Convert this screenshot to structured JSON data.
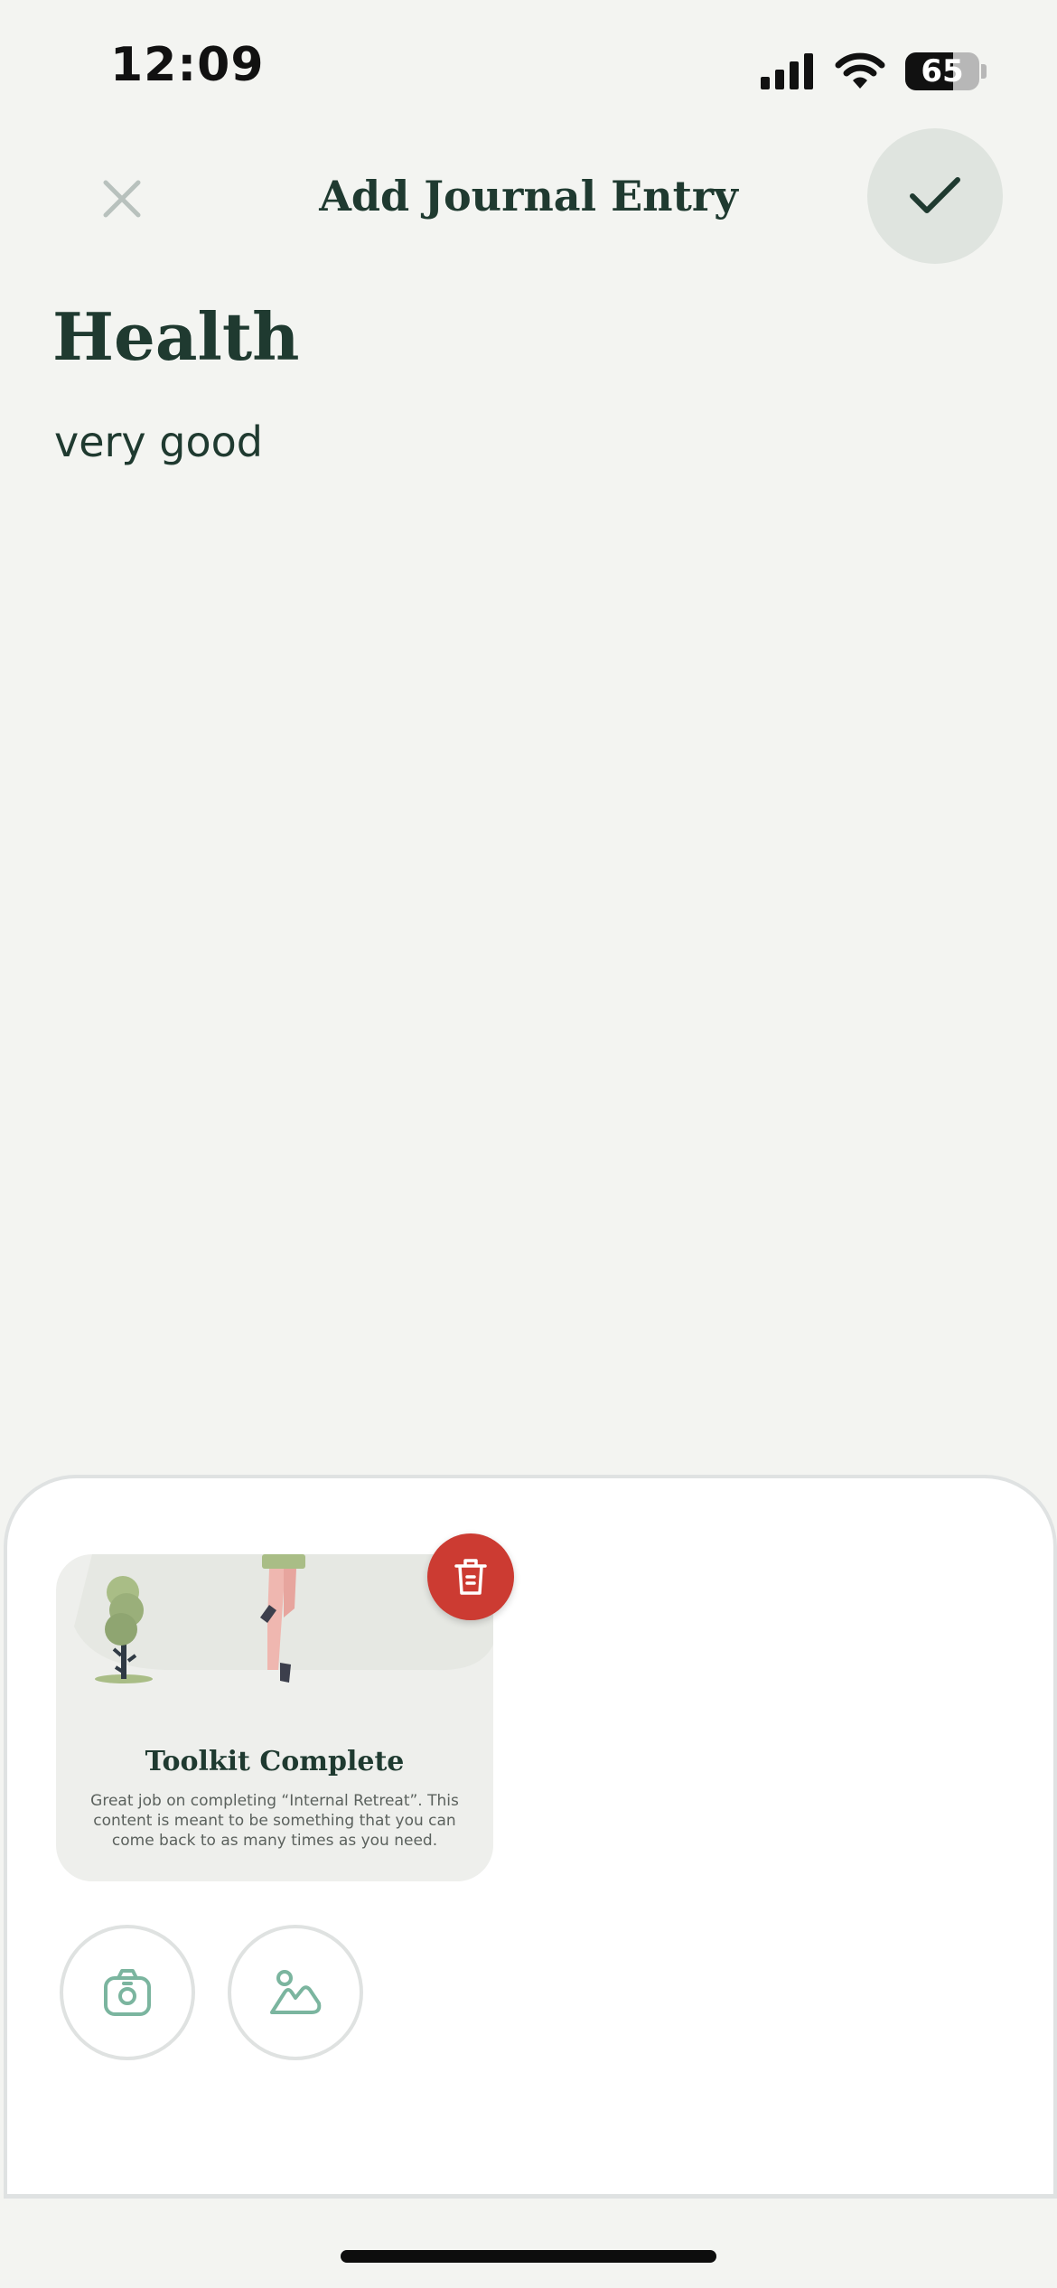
{
  "status_bar": {
    "time": "12:09",
    "battery_percent": "65",
    "battery_level": 0.65
  },
  "header": {
    "title": "Add Journal Entry"
  },
  "entry": {
    "title": "Health",
    "body": "very good"
  },
  "attachment_card": {
    "title": "Toolkit Complete",
    "description": "Great job on completing “Internal Retreat”.  This content is meant to be something that you can come back to as many times as you need."
  },
  "icons": {
    "close": "close-icon",
    "confirm": "checkmark-icon",
    "delete": "trash-icon",
    "camera": "camera-icon",
    "gallery": "image-gallery-icon"
  },
  "colors": {
    "primary_text": "#1f3a30",
    "background": "#f3f4f1",
    "delete": "#cc3b32",
    "accent_icon": "#7bb59f"
  }
}
